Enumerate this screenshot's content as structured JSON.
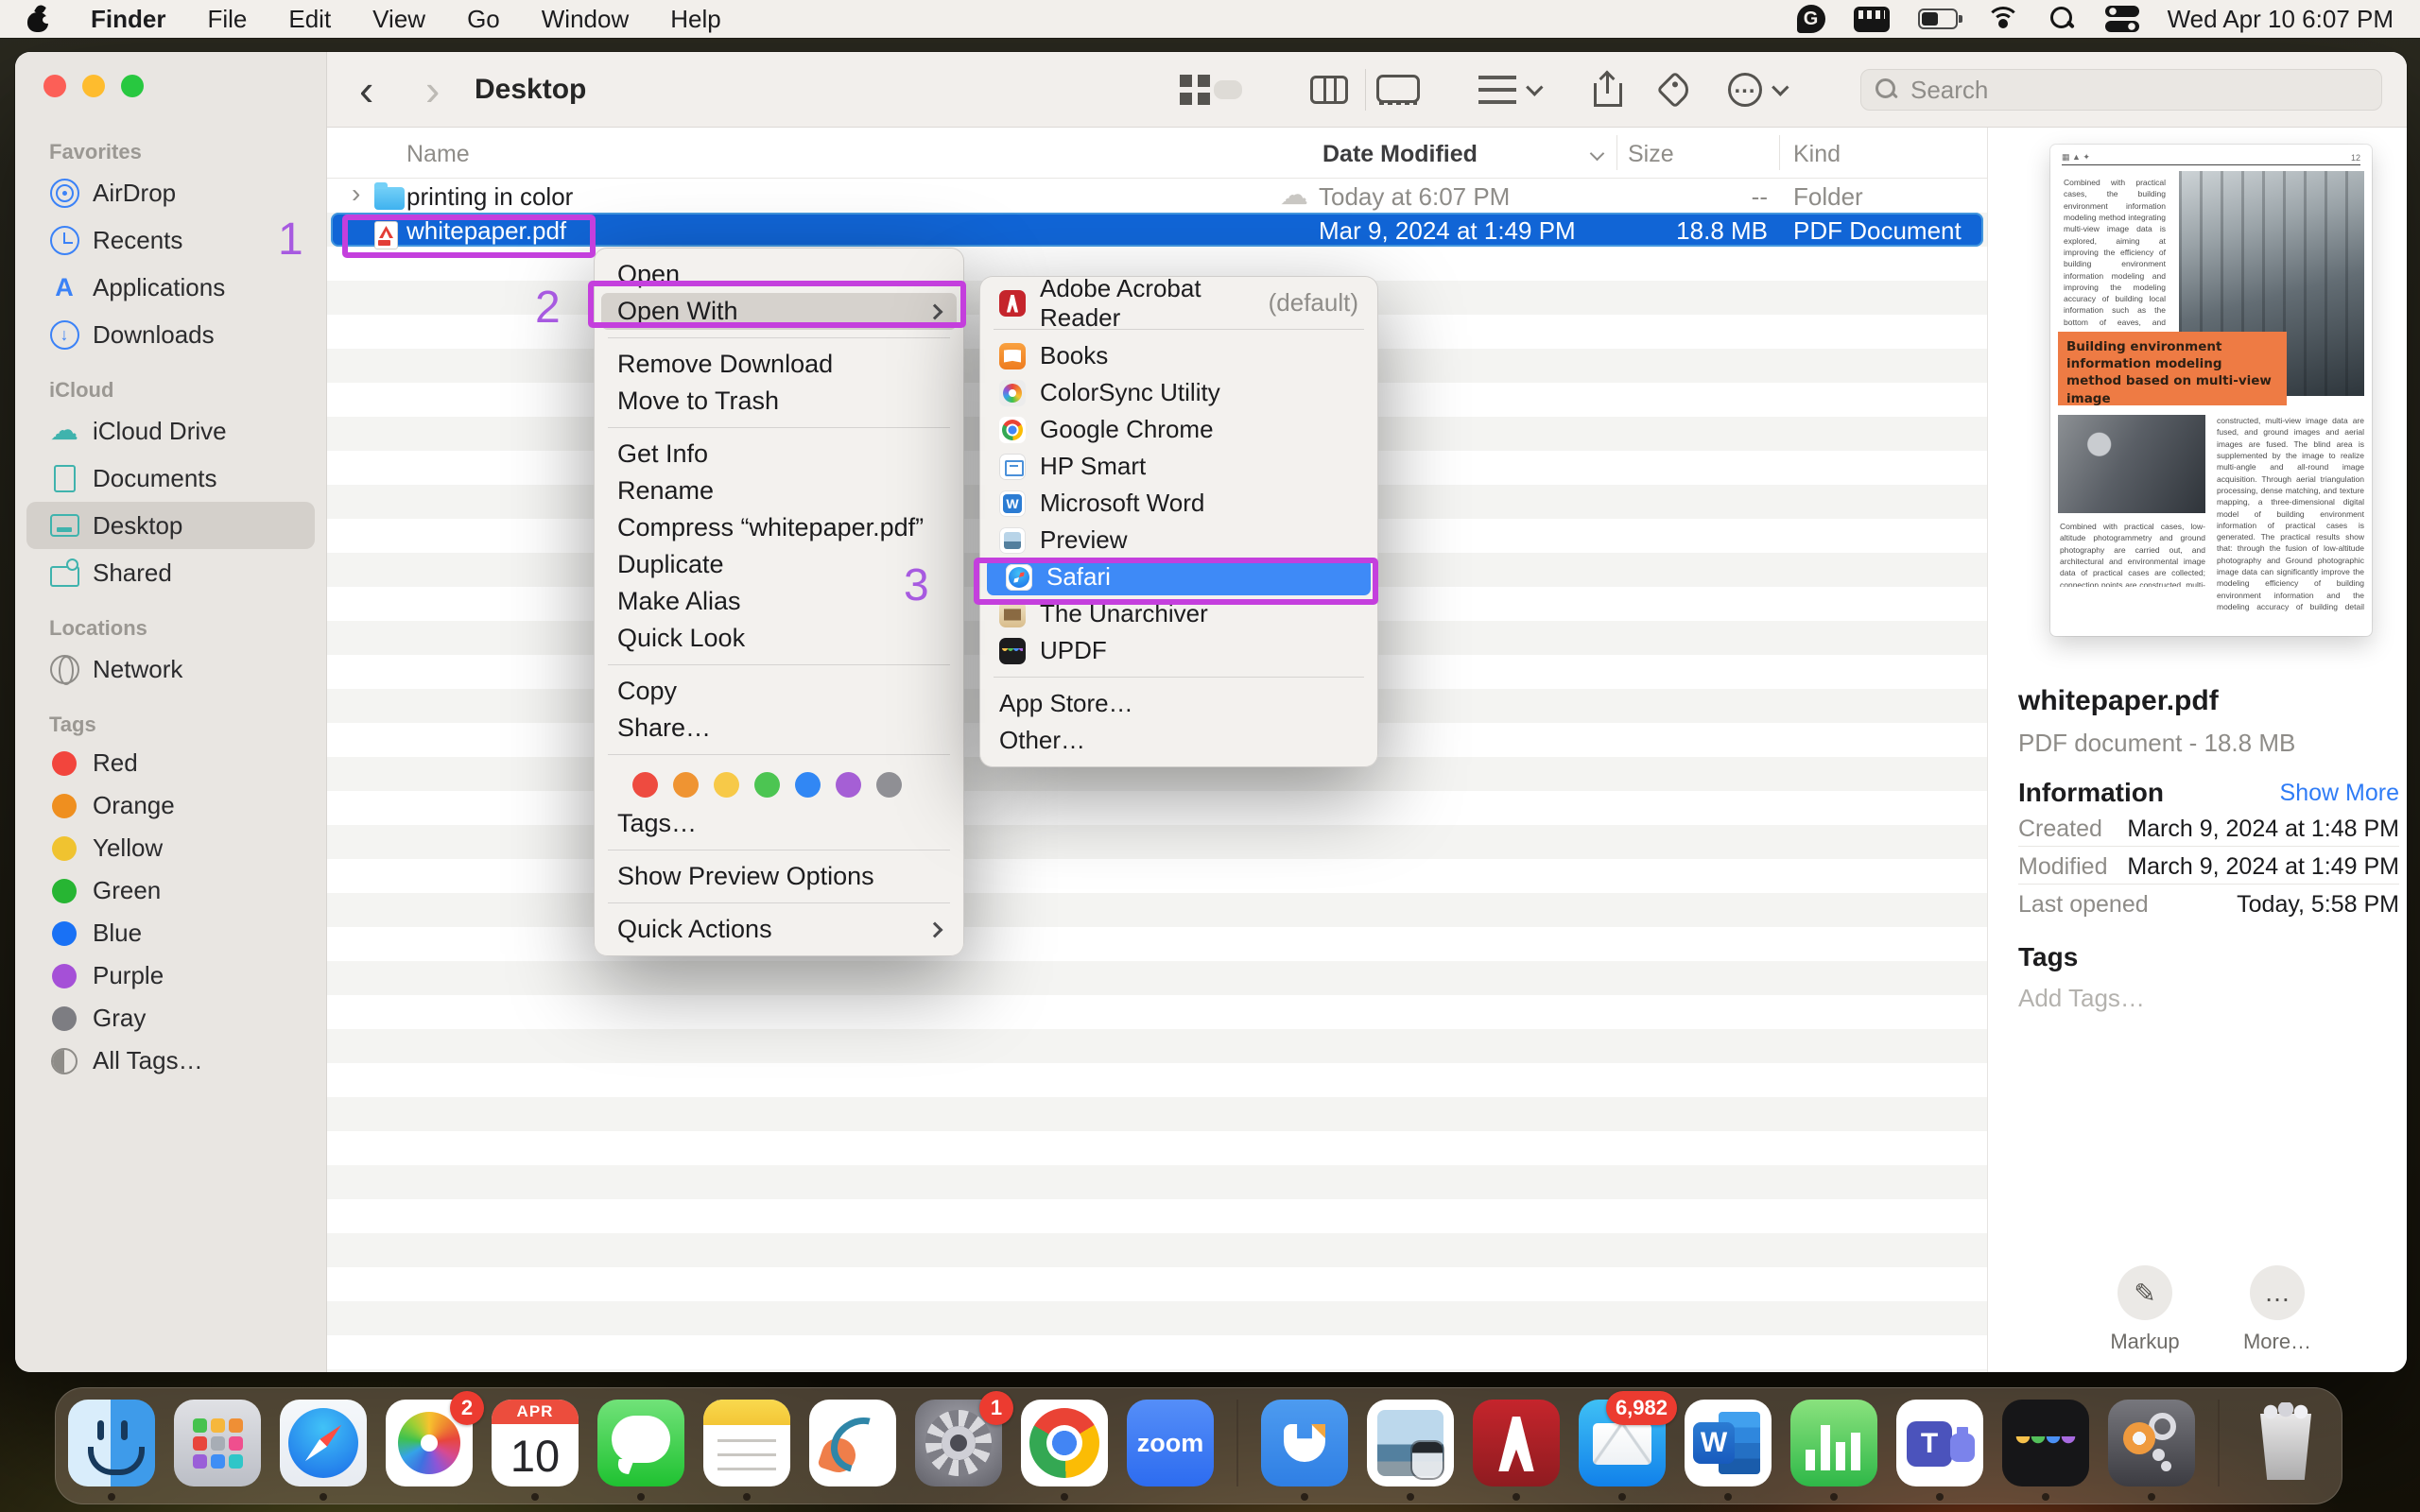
{
  "menu_bar": {
    "app_title": "Finder",
    "menus": [
      "File",
      "Edit",
      "View",
      "Go",
      "Window",
      "Help"
    ],
    "clock": "Wed Apr 10  6:07 PM"
  },
  "toolbar": {
    "title": "Desktop",
    "search_placeholder": "Search"
  },
  "sidebar": {
    "favorites": {
      "header": "Favorites",
      "items": [
        "AirDrop",
        "Recents",
        "Applications",
        "Downloads"
      ]
    },
    "icloud": {
      "header": "iCloud",
      "items": [
        "iCloud Drive",
        "Documents",
        "Desktop",
        "Shared"
      ]
    },
    "locations": {
      "header": "Locations",
      "items": [
        "Network"
      ]
    },
    "tags": {
      "header": "Tags",
      "items": [
        "Red",
        "Orange",
        "Yellow",
        "Green",
        "Blue",
        "Purple",
        "Gray",
        "All Tags…"
      ]
    }
  },
  "list": {
    "columns": [
      "Name",
      "Date Modified",
      "Size",
      "Kind"
    ],
    "rows": [
      {
        "name": "printing in color",
        "date": "Today at 6:07 PM",
        "size": "--",
        "kind": "Folder"
      },
      {
        "name": "whitepaper.pdf",
        "date": "Mar 9, 2024 at 1:49 PM",
        "size": "18.8 MB",
        "kind": "PDF Document"
      }
    ]
  },
  "context_menu": {
    "items": [
      "Open",
      "Open With",
      "Remove Download",
      "Move to Trash",
      "Get Info",
      "Rename",
      "Compress “whitepaper.pdf”",
      "Duplicate",
      "Make Alias",
      "Quick Look",
      "Copy",
      "Share…",
      "Tags…",
      "Show Preview Options",
      "Quick Actions"
    ]
  },
  "submenu": {
    "items": [
      {
        "label": "Adobe Acrobat Reader",
        "suffix": "(default)"
      },
      {
        "label": "Books"
      },
      {
        "label": "ColorSync Utility"
      },
      {
        "label": "Google Chrome"
      },
      {
        "label": "HP Smart"
      },
      {
        "label": "Microsoft Word"
      },
      {
        "label": "Preview"
      },
      {
        "label": "Safari"
      },
      {
        "label": "The Unarchiver"
      },
      {
        "label": "UPDF"
      },
      {
        "label": "App Store…"
      },
      {
        "label": "Other…"
      }
    ]
  },
  "preview": {
    "file_name": "whitepaper.pdf",
    "file_meta": "PDF document - 18.8 MB",
    "info_header": "Information",
    "show_more": "Show More",
    "rows": [
      {
        "label": "Created",
        "value": "March 9, 2024 at 1:48 PM"
      },
      {
        "label": "Modified",
        "value": "March 9, 2024 at 1:49 PM"
      },
      {
        "label": "Last opened",
        "value": "Today, 5:58 PM"
      }
    ],
    "tags_header": "Tags",
    "add_tags": "Add Tags…",
    "actions": [
      {
        "label": "Markup",
        "glyph": "✎"
      },
      {
        "label": "More…",
        "glyph": "…"
      }
    ],
    "pdf": {
      "page_num": "12",
      "headline": "Building environment information modeling method based on multi-view image",
      "col1": "Combined with practical cases, the building environment information modeling method integrating multi-view image data is explored, aiming at improving the efficiency of building environment information modeling and improving the modeling accuracy of building local information such as the bottom of eaves, and exploring the technical route of multi-view image data fusion.",
      "col2": "Combined with practical cases, low-altitude photogrammetry and ground photography are carried out, and architectural and environmental image data of practical cases are collected; connection points are constructed, multi-view image data are",
      "col3": "constructed, multi-view image data are fused, and ground images and aerial images are fused. The blind area is supplemented by the image to realize multi-angle and all-round image acquisition. Through aerial triangulation processing, dense matching, and texture mapping, a three-dimensional digital model of building environment information of practical cases is generated. The practical results show that: through the fusion of low-altitude photography and Ground photographic image data can significantly improve the modeling efficiency of building environment information and the modeling accuracy of building detail information, solve the problem of incomplete information"
    }
  },
  "dock": {
    "items": [
      {
        "name": "finder",
        "label": "Finder"
      },
      {
        "name": "launchpad",
        "label": "Launchpad"
      },
      {
        "name": "safari",
        "label": "Safari"
      },
      {
        "name": "photos",
        "label": "Photos",
        "badge": "2"
      },
      {
        "name": "calendar",
        "label": "Calendar",
        "month": "APR",
        "day": "10"
      },
      {
        "name": "messages",
        "label": "Messages"
      },
      {
        "name": "notes",
        "label": "Notes"
      },
      {
        "name": "freeform",
        "label": "Freeform"
      },
      {
        "name": "settings",
        "label": "System Settings",
        "badge": "1"
      },
      {
        "name": "chrome",
        "label": "Google Chrome"
      },
      {
        "name": "zoom",
        "label": "Zoom",
        "text": "zoom"
      },
      {
        "name": "dropover",
        "label": "Dropover"
      },
      {
        "name": "preview",
        "label": "Preview"
      },
      {
        "name": "acrobat",
        "label": "Adobe Acrobat"
      },
      {
        "name": "mail",
        "label": "Mail",
        "badge": "6,982"
      },
      {
        "name": "word",
        "label": "Microsoft Word",
        "letter": "W"
      },
      {
        "name": "numbers",
        "label": "Numbers"
      },
      {
        "name": "teams",
        "label": "Microsoft Teams",
        "letter": "T"
      },
      {
        "name": "updf",
        "label": "UPDF"
      },
      {
        "name": "keychain",
        "label": "Keychain Access"
      },
      {
        "name": "trash",
        "label": "Trash"
      }
    ]
  },
  "annotations": {
    "one": "1",
    "two": "2",
    "three": "3"
  },
  "colors": {
    "selection_blue": "#1165d6",
    "submenu_highlight_blue": "#3e8af7",
    "annotation_purple": "#c43fdd",
    "accent_orange_banner": "#ee7b44"
  }
}
